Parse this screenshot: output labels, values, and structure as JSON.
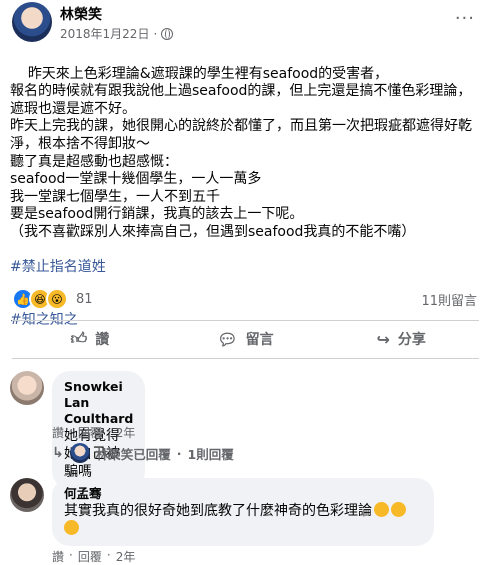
{
  "post": {
    "author": "林榮笑",
    "date": "2018年1月22日",
    "dot": "·",
    "body": "昨天來上色彩理論&遮瑕課的學生裡有seafood的受害者，\n報名的時候就有跟我說他上過seafood的課，但上完還是搞不懂色彩理論，遮瑕也還是遮不好。\n昨天上完我的課，她很開心的說終於都懂了，而且第一次把瑕疵都遮得好乾淨，根本捨不得卸妝～\n聽了真是超感動也超感慨：\nseafood一堂課十幾個學生，一人一萬多\n我一堂課七個學生，一人不到五千\n要是seafood開行銷課，我真的該去上一下呢。\n（我不喜歡踩別人來捧高自己，但遇到seafood我真的不能不嘴）",
    "tags": [
      "#禁止指名道姓",
      "#知之知之"
    ],
    "reaction_count": "81",
    "comment_count": "11則留言"
  },
  "actions": {
    "like": "讚",
    "comment": "留言",
    "share": "分享"
  },
  "comments": [
    {
      "name": "Snowkei Lan Coulthard",
      "text": "她有覺得她自己被騙嗎",
      "like": "讚",
      "reply": "回覆",
      "time": "2年"
    },
    {
      "name": "何孟骞",
      "text": "其實我真的很好奇她到底教了什麼神奇的色彩理論",
      "like": "讚",
      "reply": "回覆",
      "time": "2年"
    }
  ],
  "reply_summary": {
    "author_replied": "林榮笑已回覆",
    "replies": "1則回覆"
  }
}
